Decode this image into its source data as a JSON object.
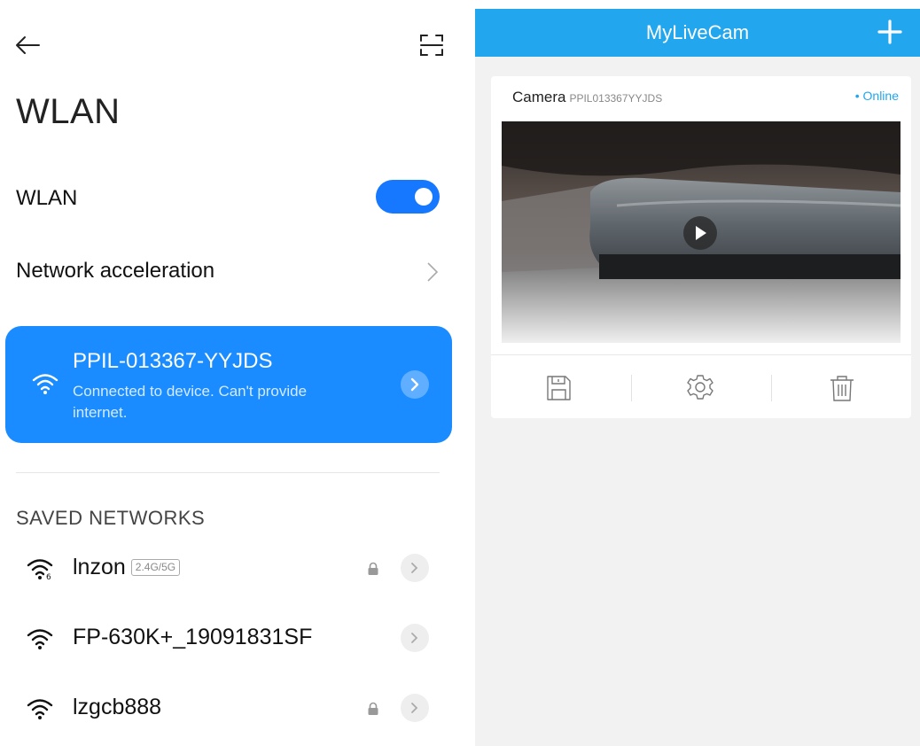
{
  "wlan": {
    "page_title": "WLAN",
    "toggle_label": "WLAN",
    "toggle_on": true,
    "acceleration_label": "Network acceleration",
    "connected": {
      "ssid": "PPIL-013367-YYJDS",
      "status": "Connected to device. Can't provide internet."
    },
    "saved_title": "SAVED NETWORKS",
    "saved_networks": [
      {
        "name": "lnzon",
        "band": "2.4G/5G",
        "locked": true
      },
      {
        "name": "FP-630K+_19091831SF",
        "band": "",
        "locked": false
      },
      {
        "name": "lzgcb888",
        "band": "",
        "locked": true
      }
    ],
    "icons": [
      "back-arrow-icon",
      "scan-icon",
      "wifi-icon",
      "lock-icon",
      "chevron-right-icon"
    ]
  },
  "app": {
    "title": "MyLiveCam",
    "camera": {
      "name": "Camera",
      "id": "PPIL013367YYJDS",
      "status": "• Online"
    },
    "actions": [
      "save-icon",
      "settings-icon",
      "delete-icon"
    ],
    "colors": {
      "header": "#22a6ed",
      "accent": "#1a8cff",
      "online": "#22a6ed"
    }
  }
}
